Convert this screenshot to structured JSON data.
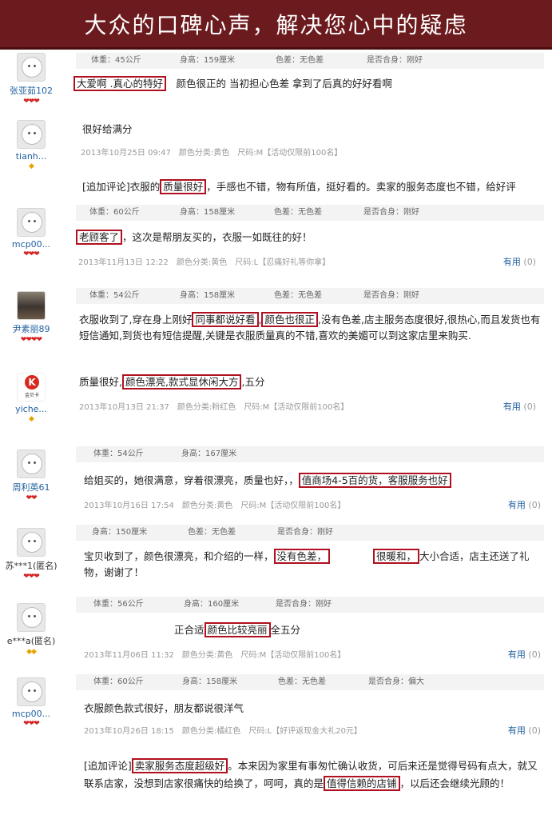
{
  "banner": {
    "title": "大众的口碑心声，解决您心中的疑虑"
  },
  "reviews": [
    {
      "user": "张亚茹102",
      "rank": "❤❤❤",
      "attrs": [
        "体重：45公斤",
        "身高：159厘米",
        "色差：无色差",
        "是否合身：刚好"
      ],
      "h1": "大爱啊 .真心的特好",
      "t1": "颜色很正的 当初担心色差 拿到了后真的好好看啊"
    },
    {
      "user": "tianh...",
      "rank": "◆",
      "t1": "很好给满分",
      "meta": "2013年10月25日 09:47　颜色分类:黄色　尺码:M【活动仅限前100名】",
      "t2": "[追加评论]衣服的",
      "h1": "质量很好",
      "t3": "，手感也不错，物有所值，挺好看的。卖家的服务态度也不错，给好评"
    },
    {
      "user": "mcp00...",
      "rank": "❤❤❤",
      "attrs": [
        "体重：60公斤",
        "身高：158厘米",
        "色差：无色差",
        "是否合身：刚好"
      ],
      "h1": "老顾客了",
      "t1": "，这次是帮朋友买的，衣服一如既往的好！",
      "meta": "2013年11月13日 12:22　颜色分类:黄色　尺码:L【忍痛好礼等你拿】",
      "useful": "有用",
      "count": "(0)"
    },
    {
      "user": "尹素丽89",
      "rank": "❤❤❤❤",
      "attrs": [
        "体重：54公斤",
        "身高：158厘米",
        "色差：无色差",
        "是否合身：刚好"
      ],
      "t1": "衣服收到了,穿在身上刚好",
      "h1": "同事都说好看",
      "t2": ",",
      "h2": "颜色也很正",
      "t3": ",没有色差,店主服务态度很好,很热心,而且发货也有短信通知,到货也有短信提醒,关键是衣服质量真的不错,喜欢的美媚可以到这家店里来购买."
    },
    {
      "user": "yiche...",
      "rank": "◆",
      "logo_k": "K",
      "logo_txt": "金贝卡",
      "t1": "质量很好,",
      "h1": "颜色漂亮,款式显休闲大方",
      "t2": ",五分",
      "meta": "2013年10月13日 21:37　颜色分类:粉红色　尺码:M【活动仅限前100名】",
      "useful": "有用",
      "count": "(0)"
    },
    {
      "user": "周利英61",
      "rank": "❤❤",
      "attrs": [
        "体重：54公斤",
        "身高：167厘米"
      ],
      "t1": "给姐买的，她很满意，穿着很漂亮，质量也好，，",
      "h1": "值商场4-5百的货，客服服务也好",
      "meta": "2013年10月16日 17:54　颜色分类:黄色　尺码:M【活动仅限前100名】",
      "useful": "有用",
      "count": "(0)"
    },
    {
      "user": "苏***1(匿名)",
      "rank": "❤❤❤",
      "attrs": [
        "身高：150厘米",
        "色差：无色差",
        "是否合身：刚好"
      ],
      "t1": "宝贝收到了，颜色很漂亮，和介绍的一样，",
      "h1": "没有色差，",
      "t2": "",
      "h2": "很暖和，",
      "t3": "大小合适，店主还送了礼物，谢谢了！"
    },
    {
      "user": "e***a(匿名)",
      "rank": "◆◆",
      "attrs": [
        "体重：56公斤",
        "身高：160厘米",
        "是否合身：刚好"
      ],
      "t1": "正合适",
      "h1": "颜色比较亮丽",
      "t2": "全五分",
      "meta": "2013年11月06日 11:32　颜色分类:黄色　尺码:M【活动仅限前100名】",
      "useful": "有用",
      "count": "(0)"
    },
    {
      "user": "mcp00...",
      "rank": "❤❤❤",
      "attrs": [
        "体重：60公斤",
        "身高：158厘米",
        "色差：无色差",
        "是否合身：偏大"
      ],
      "t1": "衣服颜色款式很好，朋友都说很洋气",
      "meta": "2013年10月26日 18:15　颜色分类:橘红色　尺码:L【好评返现金大礼20元】",
      "useful": "有用",
      "count": "(0)",
      "t2": "[追加评论]",
      "h1": "卖家服务态度超级好",
      "t3": "。本来因为家里有事匆忙确认收货，可后来还是觉得号码有点大，就又联系店家，没想到店家很痛快的给换了，呵呵，真的是",
      "h2": "值得信赖的店铺",
      "t4": "，以后还会继续光顾的！"
    }
  ]
}
